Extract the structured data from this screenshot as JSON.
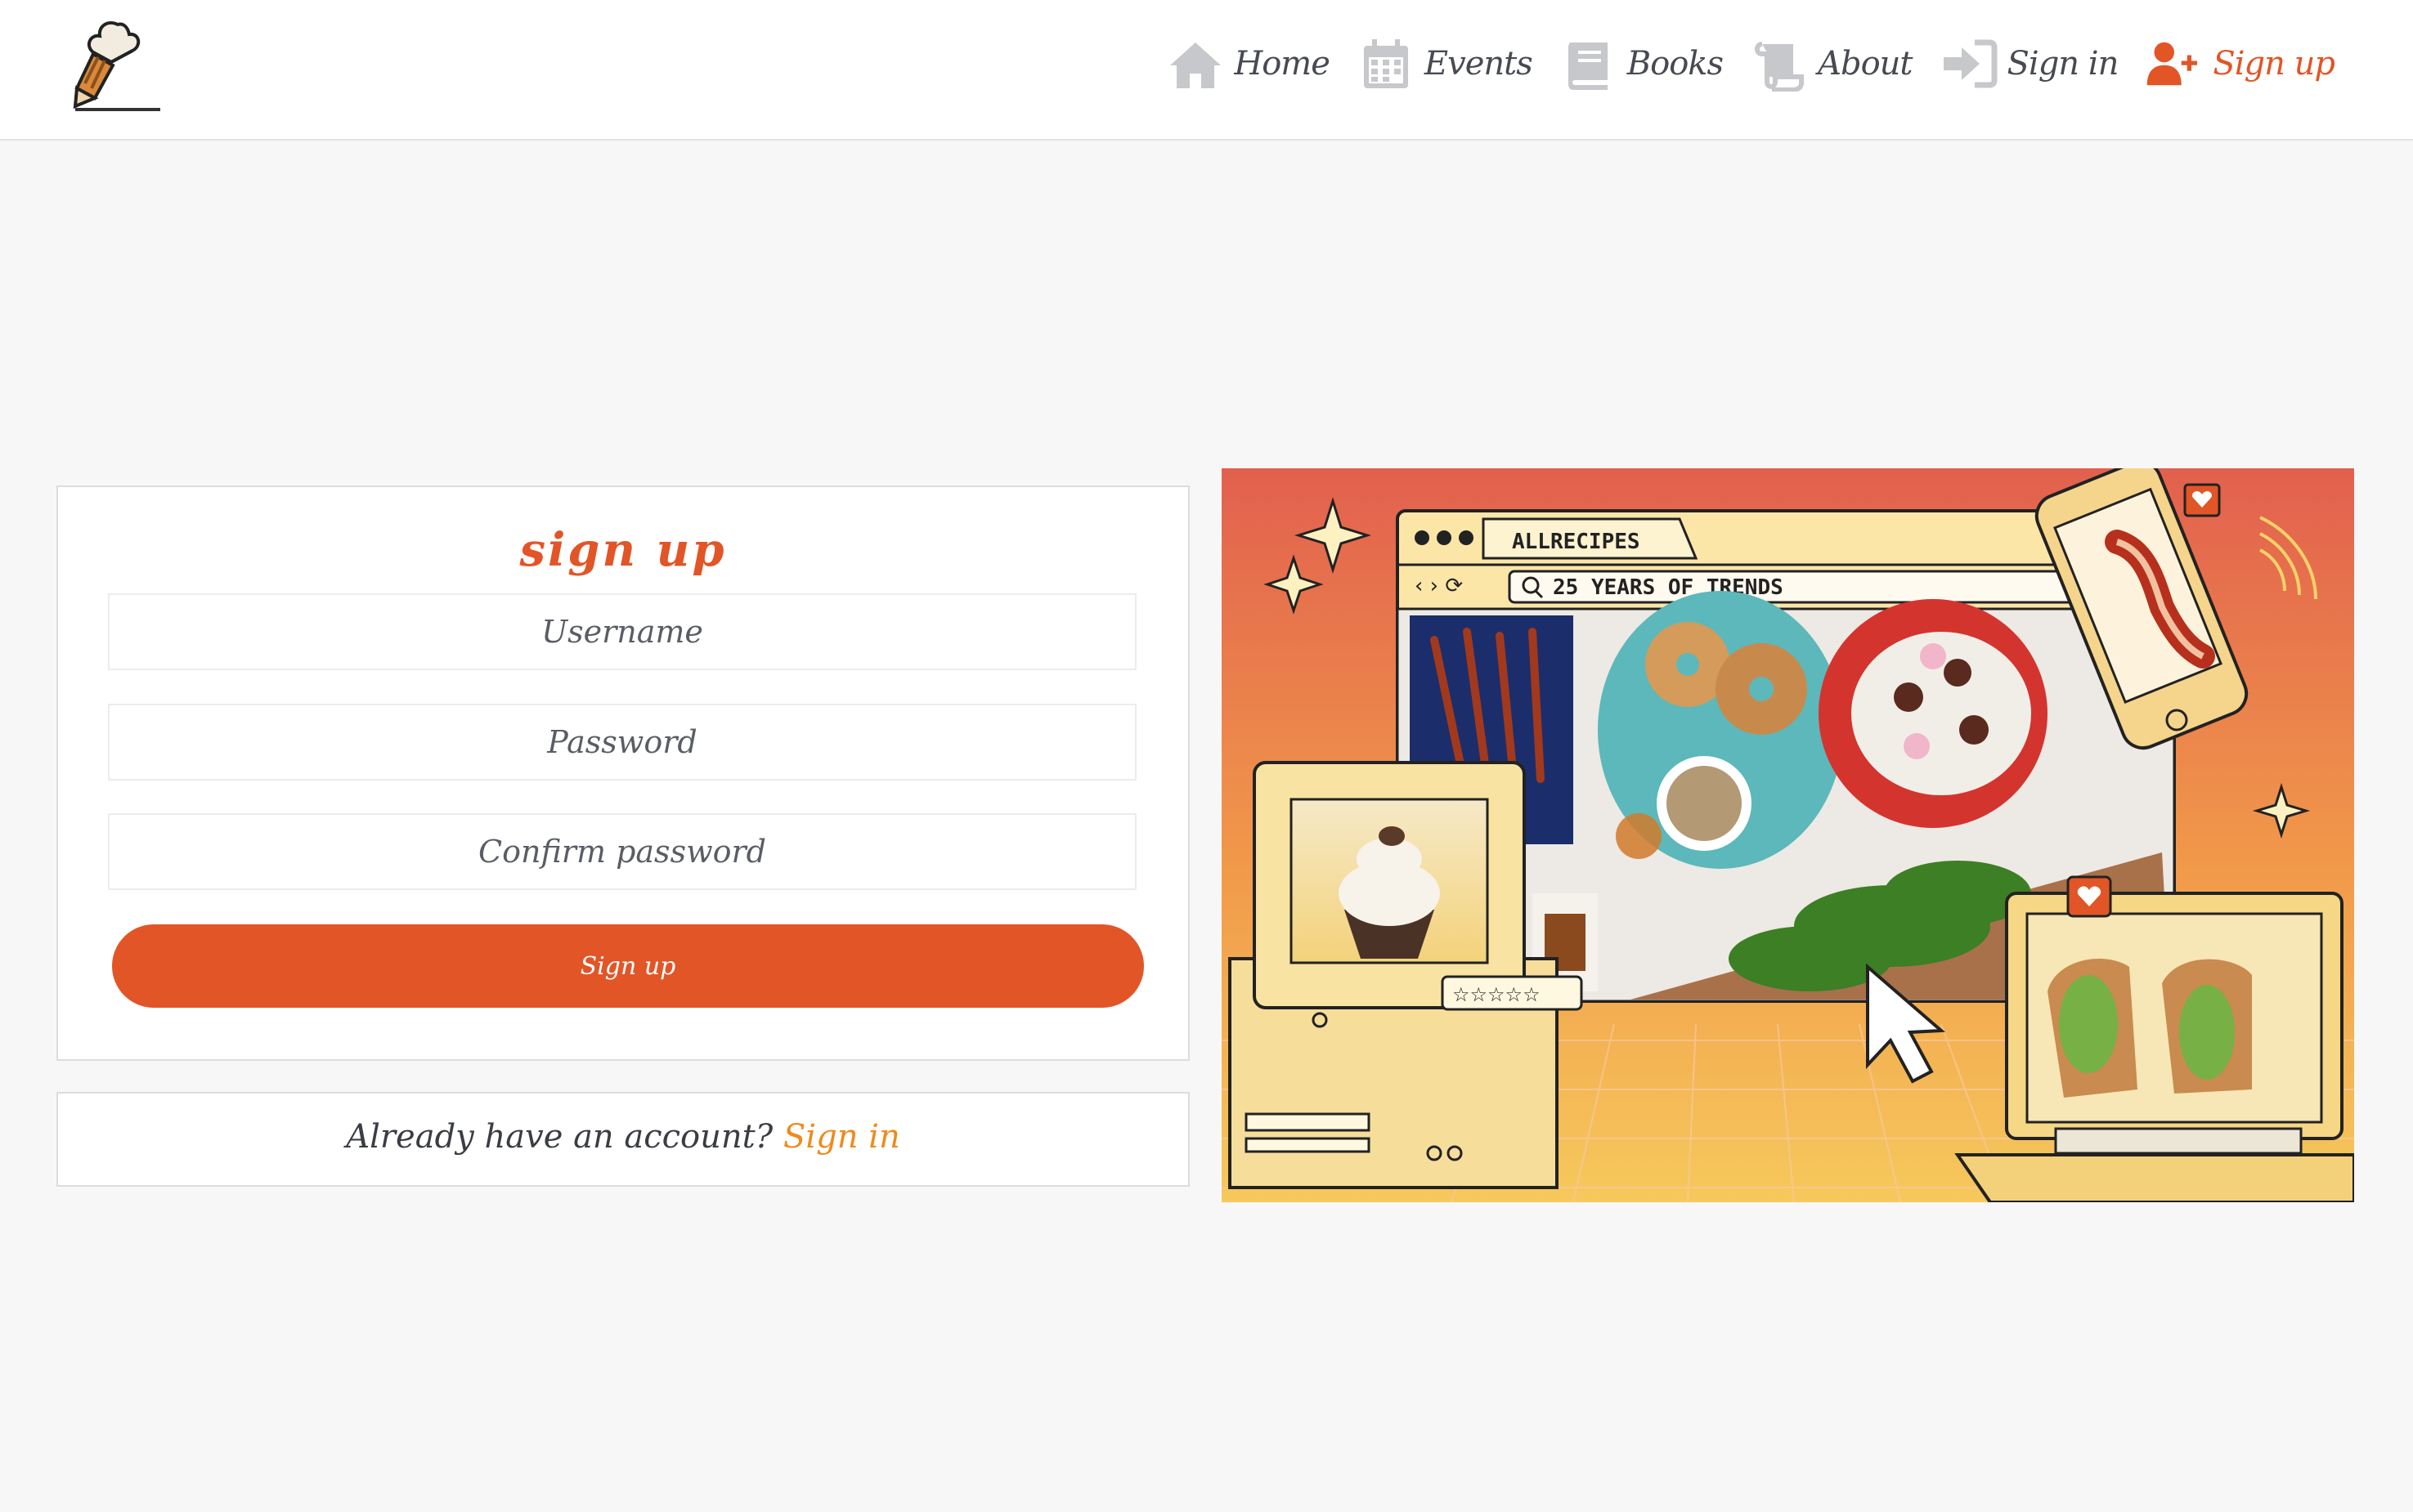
{
  "nav": {
    "items": [
      {
        "label": "Home",
        "icon": "home-icon"
      },
      {
        "label": "Events",
        "icon": "calendar-icon"
      },
      {
        "label": "Books",
        "icon": "book-icon"
      },
      {
        "label": "About",
        "icon": "scroll-icon"
      },
      {
        "label": "Sign in",
        "icon": "sign-in-icon"
      },
      {
        "label": "Sign up",
        "icon": "user-plus-icon"
      }
    ],
    "active": "Sign up"
  },
  "signup": {
    "title": "sign up",
    "username_placeholder": "Username",
    "password_placeholder": "Password",
    "confirm_placeholder": "Confirm password",
    "button_label": "Sign up"
  },
  "signin_prompt": {
    "text": "Already have an account?",
    "link": "Sign in"
  },
  "hero": {
    "tab_label": "ALLRECIPES",
    "search_text": "25 YEARS OF TRENDS"
  },
  "colors": {
    "accent": "#e25527",
    "link": "#ef8a1d",
    "nav_icon": "#c7c8cc",
    "nav_text": "#474a52",
    "background": "#f7f7f7"
  }
}
